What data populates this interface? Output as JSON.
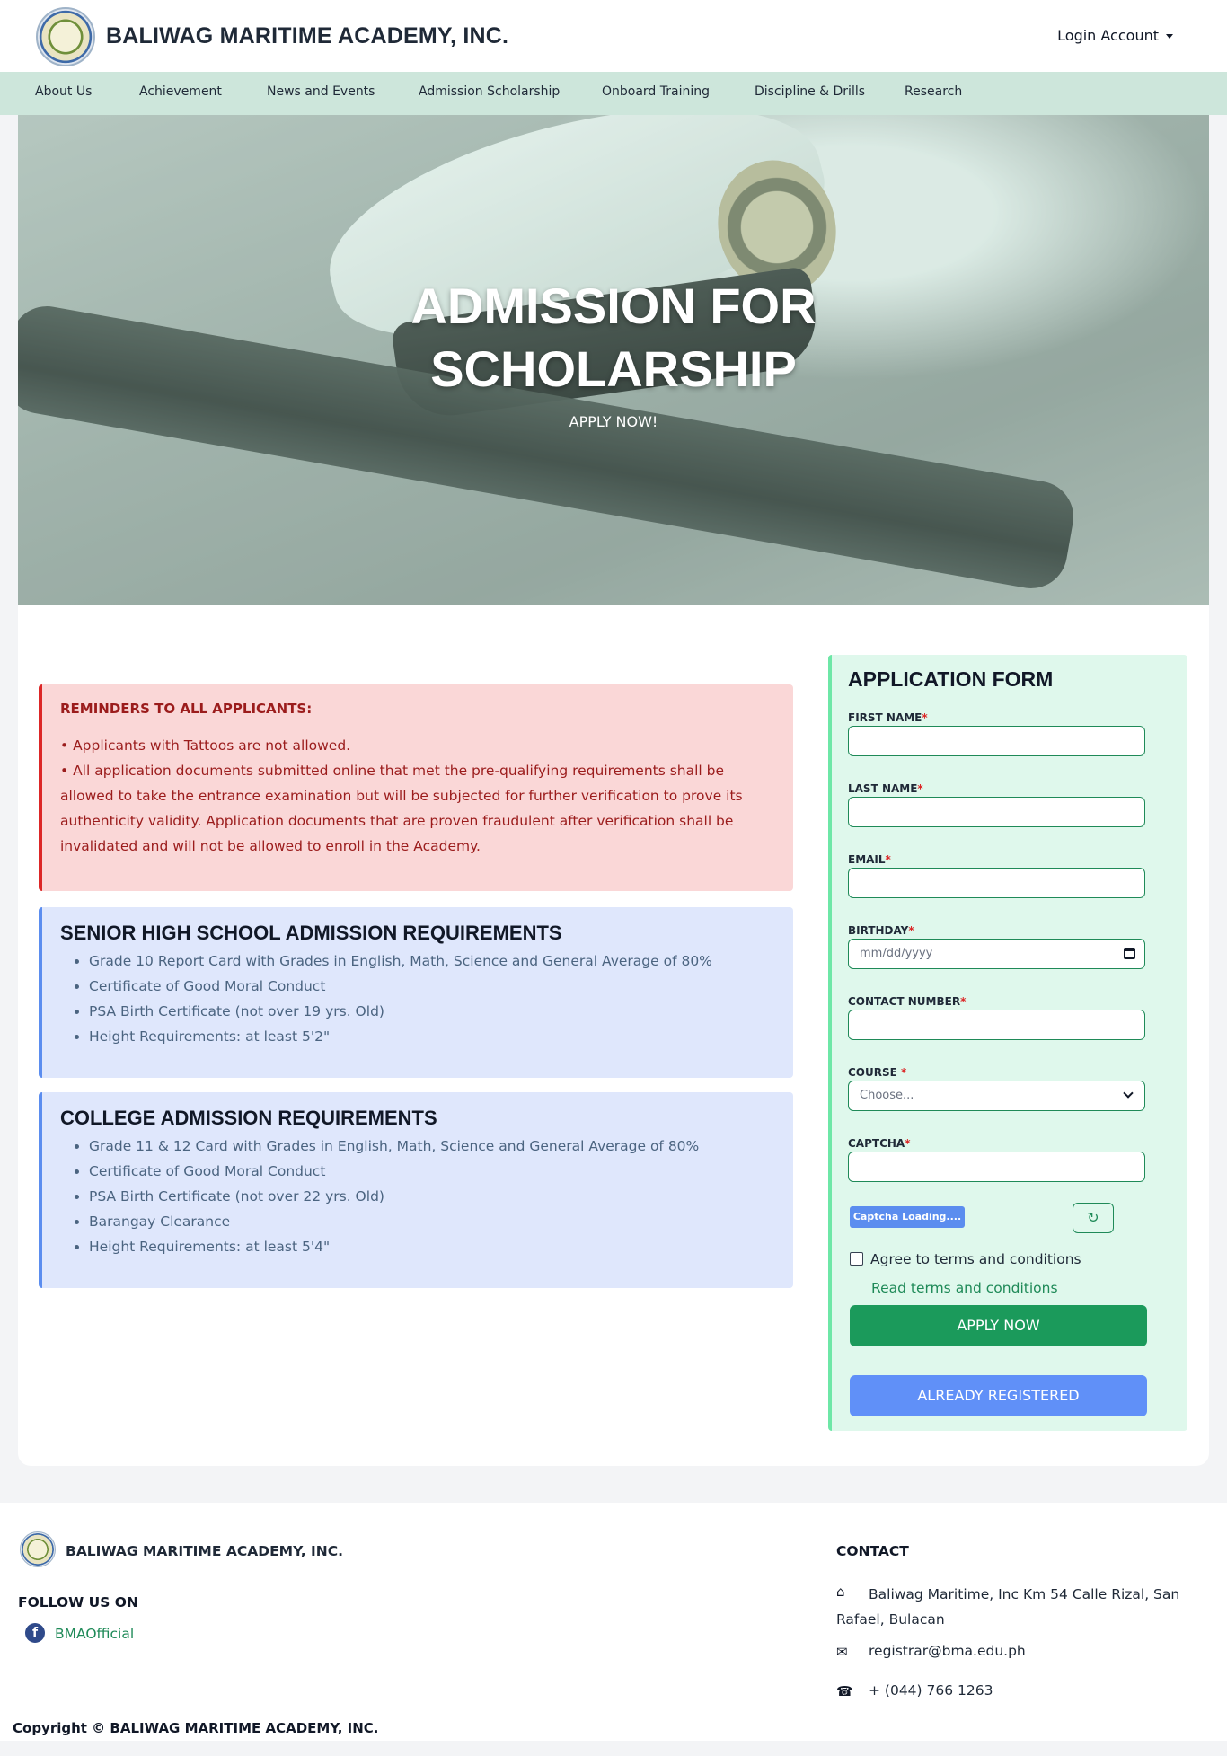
{
  "header": {
    "brand": "BALIWAG MARITIME ACADEMY, INC.",
    "login": "Login Account"
  },
  "nav": {
    "items": [
      "About Us",
      "Achievement",
      "News and Events",
      "Admission Scholarship",
      "Onboard Training",
      "Discipline & Drills",
      "Research"
    ]
  },
  "hero": {
    "title_line1": "ADMISSION FOR",
    "title_line2": "SCHOLARSHIP",
    "subtitle": "APPLY NOW!"
  },
  "reminders": {
    "title": "REMINDERS TO ALL APPLICANTS:",
    "line1": "• Applicants with Tattoos are not allowed.",
    "line2": "• All application documents submitted online that met the pre-qualifying requirements shall be allowed to take the entrance examination but will be subjected for further verification to prove its authenticity validity. Application documents that are proven fraudulent after verification shall be invalidated and will not be allowed to enroll in the Academy."
  },
  "shs": {
    "title": "SENIOR HIGH SCHOOL ADMISSION REQUIREMENTS",
    "items": [
      "Grade 10 Report Card with Grades in English, Math, Science and General Average of 80%",
      "Certificate of Good Moral Conduct",
      "PSA Birth Certificate (not over 19 yrs. Old)",
      "Height Requirements: at least 5'2\""
    ]
  },
  "college": {
    "title": "COLLEGE ADMISSION REQUIREMENTS",
    "items": [
      "Grade 11 & 12 Card with Grades in English, Math, Science and General Average of 80%",
      "Certificate of Good Moral Conduct",
      "PSA Birth Certificate (not over 22 yrs. Old)",
      "Barangay Clearance",
      "Height Requirements: at least 5'4\""
    ]
  },
  "form": {
    "title": "APPLICATION FORM",
    "first_name": "FIRST NAME",
    "last_name": "LAST NAME",
    "email": "EMAIL",
    "birthday": "BIRTHDAY",
    "birthday_placeholder": "mm/dd/yyyy",
    "contact": "CONTACT NUMBER",
    "course": "COURSE",
    "course_placeholder": "Choose...",
    "captcha": "CAPTCHA",
    "captcha_loading": "Captcha Loading....",
    "refresh_icon": "↻",
    "agree": "Agree to terms and conditions",
    "terms_link": "Read terms and conditions",
    "apply_button": "APPLY NOW",
    "registered_button": "ALREADY REGISTERED",
    "required_mark": "*"
  },
  "footer": {
    "brand": "BALIWAG MARITIME ACADEMY, INC.",
    "follow": "FOLLOW US ON",
    "facebook": "BMAOfficial",
    "contact_title": "CONTACT",
    "address": "Baliwag Maritime, Inc Km 54 Calle Rizal, San Rafael, Bulacan",
    "email": "registrar@bma.edu.ph",
    "phone": "+ (044) 766 1263",
    "copyright": "Copyright © BALIWAG MARITIME ACADEMY, INC."
  },
  "colors": {
    "nav_bg": "#cde6db",
    "alert_bg": "#fad7d7",
    "req_bg": "#dfe7fc",
    "form_bg": "#dff8ec",
    "apply_green": "#1b9a5b",
    "registered_blue": "#6090f8"
  },
  "icons": [
    "caret-down-icon",
    "calendar-icon",
    "chevron-down-icon",
    "refresh-icon",
    "facebook-icon",
    "home-icon",
    "envelope-icon",
    "phone-icon"
  ]
}
